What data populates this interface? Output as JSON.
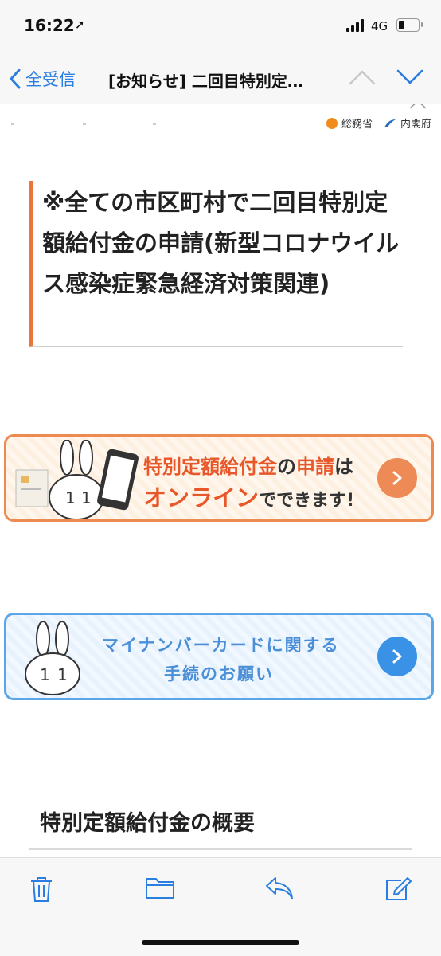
{
  "status_bar": {
    "time": "16:22",
    "network": "4G"
  },
  "nav": {
    "back_label": "全受信",
    "title": "[お知らせ] 二回目特別定…"
  },
  "email": {
    "logos": [
      "総務省",
      "内閣府"
    ],
    "heading": "※全ての市区町村で二回目特別定額給付金の申請(新型コロナウイルス感染症緊急経済対策関連)",
    "banner_online": {
      "line1_a": "特別定額給付金",
      "line1_b": "の",
      "line1_c": "申請",
      "line1_d": "は",
      "line2_a": "オンライン",
      "line2_b": "でできます!"
    },
    "banner_mynumber": {
      "line1": "マイナンバーカードに関する",
      "line2": "手続のお願い"
    },
    "section_title": "特別定額給付金の概要"
  },
  "toolbar": {
    "items": [
      "trash-icon",
      "folder-icon",
      "reply-icon",
      "compose-icon"
    ]
  },
  "colors": {
    "accent": "#2a7de1",
    "orange": "#e9763a",
    "blue": "#3a92e6"
  }
}
